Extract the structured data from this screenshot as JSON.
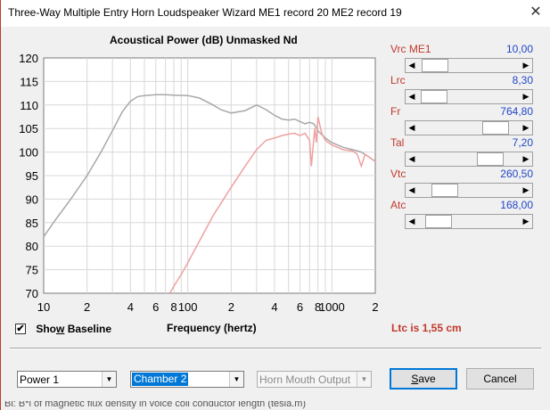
{
  "window": {
    "title": "Three-Way Multiple Entry Horn Loudspeaker Wizard   ME1 record 20   ME2 record 19",
    "close_glyph": "✕"
  },
  "chart": {
    "heading": "Acoustical Power (dB)   Unmasked   Nd",
    "xlabel": "Frequency (hertz)"
  },
  "chart_data": {
    "type": "line",
    "title": "Acoustical Power (dB)   Unmasked   Nd",
    "xlabel": "Frequency (hertz)",
    "ylabel": "",
    "xscale": "log",
    "xlim": [
      10,
      2000
    ],
    "ylim": [
      70,
      120
    ],
    "grid": true,
    "y_ticks": [
      70,
      75,
      80,
      85,
      90,
      95,
      100,
      105,
      110,
      115,
      120
    ],
    "x_ticks": [
      {
        "value": 10,
        "label": "10"
      },
      {
        "value": 20,
        "label": "2"
      },
      {
        "value": 40,
        "label": "4"
      },
      {
        "value": 60,
        "label": "6"
      },
      {
        "value": 80,
        "label": "8"
      },
      {
        "value": 100,
        "label": "100"
      },
      {
        "value": 200,
        "label": "2"
      },
      {
        "value": 400,
        "label": "4"
      },
      {
        "value": 600,
        "label": "6"
      },
      {
        "value": 800,
        "label": "8"
      },
      {
        "value": 1000,
        "label": "1000"
      },
      {
        "value": 2000,
        "label": "2"
      }
    ],
    "series": [
      {
        "color": "#a8a8a8",
        "x": [
          10,
          12,
          15,
          20,
          25,
          30,
          35,
          40,
          45,
          50,
          60,
          70,
          80,
          100,
          120,
          150,
          170,
          200,
          250,
          300,
          350,
          400,
          450,
          500,
          550,
          600,
          650,
          700,
          750,
          800,
          900,
          1000,
          1200,
          1400,
          1600,
          1800,
          2000
        ],
        "y": [
          82,
          85.5,
          89.5,
          95,
          100,
          104.5,
          108.5,
          110.8,
          111.8,
          112,
          112.2,
          112.2,
          112.1,
          112,
          111.5,
          110,
          109,
          108.3,
          108.8,
          110,
          109,
          107.8,
          107,
          106.8,
          107,
          106.5,
          106,
          106.3,
          106,
          104.5,
          103,
          102,
          101,
          100.5,
          100,
          99,
          98
        ]
      },
      {
        "color": "#f0a0a0",
        "x": [
          75,
          80,
          90,
          100,
          120,
          150,
          200,
          250,
          300,
          350,
          400,
          450,
          500,
          550,
          600,
          650,
          700,
          720,
          740,
          760,
          780,
          800,
          850,
          900,
          1000,
          1200,
          1400,
          1500,
          1600,
          1700,
          1800,
          2000
        ],
        "y": [
          70,
          71.5,
          74,
          76.5,
          81,
          86.5,
          92.5,
          97,
          100.5,
          102.5,
          103,
          103.5,
          103.8,
          104,
          103.5,
          104,
          102.5,
          97,
          101,
          105,
          102,
          107.5,
          104,
          102.5,
          101.5,
          100.5,
          100.2,
          99.5,
          97,
          99.5,
          99,
          98
        ]
      }
    ]
  },
  "sliders": [
    {
      "label": "Vrc  ME1",
      "value": "10,00",
      "position": 0.05
    },
    {
      "label": "Lrc",
      "value": "8,30",
      "position": 0.04
    },
    {
      "label": "Fr",
      "value": "764,80",
      "position": 0.86
    },
    {
      "label": "Tal",
      "value": "7,20",
      "position": 0.78
    },
    {
      "label": "Vtc",
      "value": "260,50",
      "position": 0.18
    },
    {
      "label": "Atc",
      "value": "168,00",
      "position": 0.1
    }
  ],
  "baseline": {
    "label": "Show Baseline",
    "checked": true,
    "check_glyph": "✔"
  },
  "ltc_text": "Ltc is 1,55 cm",
  "selects": {
    "power": {
      "value": "Power 1"
    },
    "chamber": {
      "value": "Chamber 2"
    },
    "horn": {
      "value": "Horn Mouth Output"
    }
  },
  "buttons": {
    "save": "Save",
    "cancel": "Cancel"
  },
  "status_text": "Bl: B*l of magnetic flux density in voice coil conductor length   (tesla.m)"
}
